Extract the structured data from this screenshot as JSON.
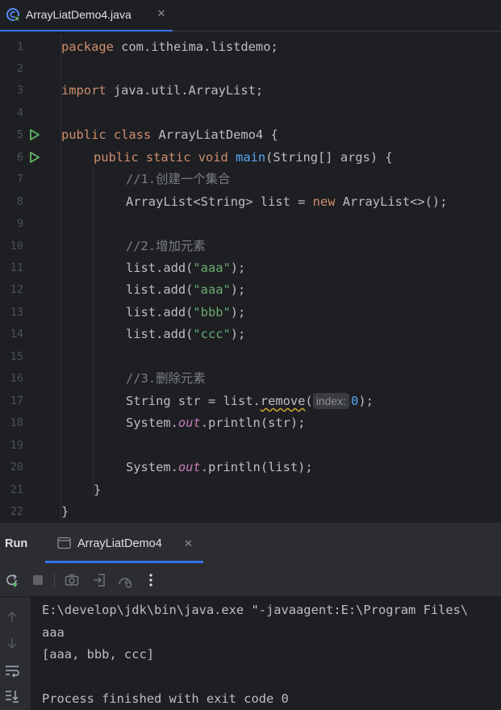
{
  "editor_tab": {
    "filename": "ArrayLiatDemo4.java",
    "close": "✕"
  },
  "line_numbers": [
    "1",
    "2",
    "3",
    "4",
    "5",
    "6",
    "7",
    "8",
    "9",
    "10",
    "11",
    "12",
    "13",
    "14",
    "15",
    "16",
    "17",
    "18",
    "19",
    "20",
    "21",
    "22"
  ],
  "code": {
    "l1_kw": "package",
    "l1_rest": " com.itheima.listdemo;",
    "l3_kw": "import",
    "l3_rest": " java.util.ArrayList;",
    "l5_kw": "public class",
    "l5_rest": " ArrayLiatDemo4 {",
    "l6_kw": "public static void",
    "l6_fn": "main",
    "l6_rest": "(String[] args) {",
    "l7_cm": "//1.创建一个集合",
    "l8_a": "ArrayList<String> list = ",
    "l8_kw": "new",
    "l8_b": " ArrayList<>();",
    "l10_cm": "//2.增加元素",
    "l11_a": "list.add(",
    "l11_s": "\"aaa\"",
    "l11_b": ");",
    "l12_a": "list.add(",
    "l12_s": "\"aaa\"",
    "l12_b": ");",
    "l13_a": "list.add(",
    "l13_s": "\"bbb\"",
    "l13_b": ");",
    "l14_a": "list.add(",
    "l14_s": "\"ccc\"",
    "l14_b": ");",
    "l16_cm": "//3.删除元素",
    "l17_a": "String str = list.",
    "l17_warn": "remove",
    "l17_b": "(",
    "l17_hint": "index:",
    "l17_num": "0",
    "l17_c": ");",
    "l18_a": "System.",
    "l18_it": "out",
    "l18_b": ".println(str);",
    "l20_a": "System.",
    "l20_it": "out",
    "l20_b": ".println(list);",
    "l21": "}",
    "l22": "}"
  },
  "run_panel": {
    "title": "Run",
    "tab_label": "ArrayLiatDemo4",
    "tab_close": "✕"
  },
  "console": {
    "lines": [
      "E:\\develop\\jdk\\bin\\java.exe \"-javaagent:E:\\Program Files\\",
      "aaa",
      "[aaa, bbb, ccc]",
      "",
      "Process finished with exit code 0"
    ]
  },
  "colors": {
    "background": "#1e1f22",
    "panel": "#2b2d30",
    "keyword": "#cf8e6d",
    "function": "#56a8f5",
    "string": "#6aab73",
    "comment": "#7a7e85",
    "static_field": "#c77dbb",
    "run_green": "#5fb865",
    "accent": "#3574f0"
  },
  "icons": {
    "file": "java-class-icon",
    "run_markers": "run-gutter-icon",
    "toolbar": [
      "rerun-icon",
      "stop-icon",
      "screenshot-icon",
      "exit-icon",
      "dump-icon",
      "more-icon"
    ],
    "side": [
      "scroll-up-icon",
      "scroll-down-icon",
      "soft-wrap-icon",
      "scroll-to-end-icon"
    ]
  }
}
